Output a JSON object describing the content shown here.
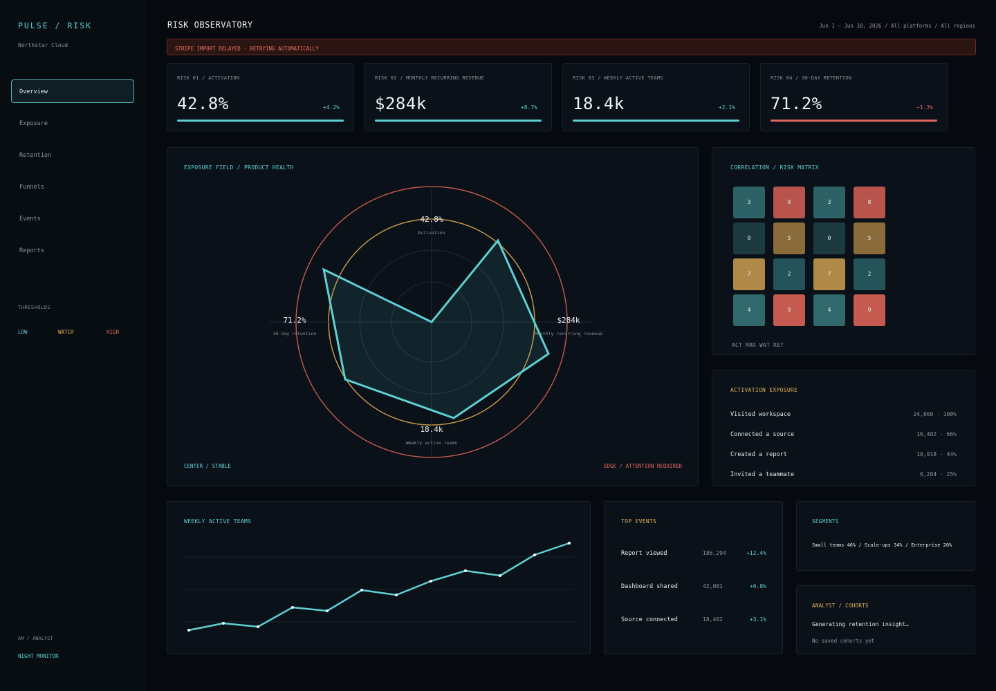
{
  "brand": {
    "name": "PULSE / RISK",
    "org": "Northstar Cloud"
  },
  "nav": [
    {
      "label": "Overview",
      "active": true
    },
    {
      "label": "Exposure",
      "active": false
    },
    {
      "label": "Retention",
      "active": false
    },
    {
      "label": "Funnels",
      "active": false
    },
    {
      "label": "Events",
      "active": false
    },
    {
      "label": "Reports",
      "active": false
    }
  ],
  "thresholds": {
    "title": "THRESHOLDS",
    "low": "LOW",
    "watch": "WATCH",
    "high": "HIGH"
  },
  "user": {
    "role": "AM / ANALYST",
    "mode": "NIGHT MONITOR"
  },
  "header": {
    "title": "RISK OBSERVATORY",
    "range": "Jun 1 – Jun 30, 2026 / All platforms / All regions"
  },
  "alert": {
    "text": "STRIPE IMPORT DELAYED · RETRYING AUTOMATICALLY"
  },
  "kpis": [
    {
      "label": "RISK 01 / ACTIVATION",
      "value": "42.8%",
      "delta": "+4.2%",
      "trend": "up"
    },
    {
      "label": "RISK 02 / MONTHLY RECURRING REVENUE",
      "value": "$284k",
      "delta": "+8.7%",
      "trend": "up"
    },
    {
      "label": "RISK 03 / WEEKLY ACTIVE TEAMS",
      "value": "18.4k",
      "delta": "+2.1%",
      "trend": "up"
    },
    {
      "label": "RISK 04 / 30-DAY RETENTION",
      "value": "71.2%",
      "delta": "−1.3%",
      "trend": "down"
    }
  ],
  "colors": {
    "accent": "#5ed0d3",
    "warn": "#e0b05a",
    "danger": "#e0685c"
  },
  "exposure": {
    "title": "EXPOSURE FIELD / PRODUCT HEALTH",
    "center_label": "CENTER / STABLE",
    "edge_label": "EDGE / ATTENTION REQUIRED",
    "axes": [
      {
        "value": "42.8%",
        "label": "Activation"
      },
      {
        "value": "$284k",
        "label": "Monthly recurring revenue"
      },
      {
        "value": "18.4k",
        "label": "Weekly active teams"
      },
      {
        "value": "71.2%",
        "label": "30-day retention"
      }
    ]
  },
  "matrix": {
    "title": "CORRELATION / RISK MATRIX",
    "footer": "ACT MRR WAT RET",
    "rows": [
      [
        3,
        8,
        3,
        8
      ],
      [
        0,
        5,
        0,
        5
      ],
      [
        7,
        2,
        7,
        2
      ],
      [
        4,
        9,
        4,
        9
      ]
    ]
  },
  "funnel": {
    "title": "ACTIVATION EXPOSURE",
    "steps": [
      {
        "label": "Visited workspace",
        "value": "24,860 · 100%"
      },
      {
        "label": "Connected a source",
        "value": "16,402 · 66%"
      },
      {
        "label": "Created a report",
        "value": "10,918 · 44%"
      },
      {
        "label": "Invited a teammate",
        "value": "6,204 · 25%"
      }
    ]
  },
  "wat": {
    "title": "WEEKLY ACTIVE TEAMS"
  },
  "events": {
    "title": "TOP EVENTS",
    "rows": [
      {
        "name": "Report viewed",
        "count": "186,294",
        "delta": "+12.4%"
      },
      {
        "name": "Dashboard shared",
        "count": "42,081",
        "delta": "+6.8%"
      },
      {
        "name": "Source connected",
        "count": "18,402",
        "delta": "+3.1%"
      }
    ]
  },
  "segments": {
    "title": "SEGMENTS",
    "text": "Small teams 46% / Scale-ups 34% / Enterprise 20%"
  },
  "analyst": {
    "title": "ANALYST / COHORTS",
    "status": "Generating retention insight…",
    "empty": "No saved cohorts yet"
  }
}
